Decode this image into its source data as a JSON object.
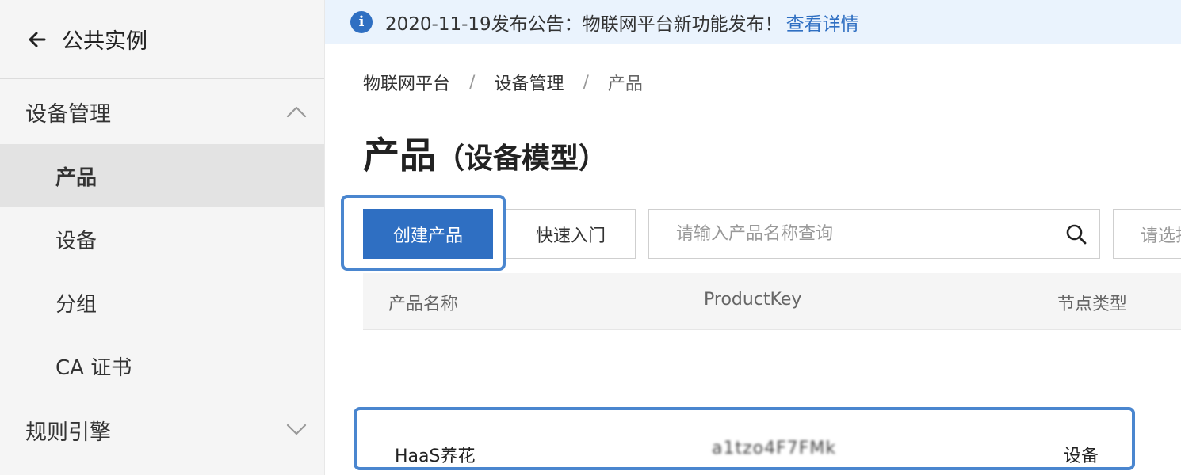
{
  "sidebar": {
    "back_label": "公共实例",
    "groups": [
      {
        "label": "设备管理",
        "expanded": true
      },
      {
        "label": "规则引擎",
        "expanded": false
      }
    ],
    "items": [
      {
        "label": "产品",
        "active": true
      },
      {
        "label": "设备",
        "active": false
      },
      {
        "label": "分组",
        "active": false
      },
      {
        "label": "CA 证书",
        "active": false
      }
    ]
  },
  "notice": {
    "text": "2020-11-19发布公告：物联网平台新功能发布！",
    "link": "查看详情"
  },
  "breadcrumb": [
    "物联网平台",
    "设备管理",
    "产品"
  ],
  "page_title": {
    "main": "产品",
    "sub": "（设备模型）"
  },
  "toolbar": {
    "create_label": "创建产品",
    "quickstart_label": "快速入门",
    "search_placeholder": "请输入产品名称查询",
    "select_placeholder": "请选择"
  },
  "table": {
    "columns": [
      "产品名称",
      "ProductKey",
      "节点类型"
    ],
    "rows": [
      {
        "name": "HaaS养花",
        "product_key": "a1tzo4F7FMk",
        "node_type": "设备"
      }
    ]
  },
  "colors": {
    "primary": "#2f6fc2",
    "highlight": "#4a86cf",
    "notice_bg": "#eaf3fd",
    "sidebar_bg": "#f5f5f5"
  }
}
